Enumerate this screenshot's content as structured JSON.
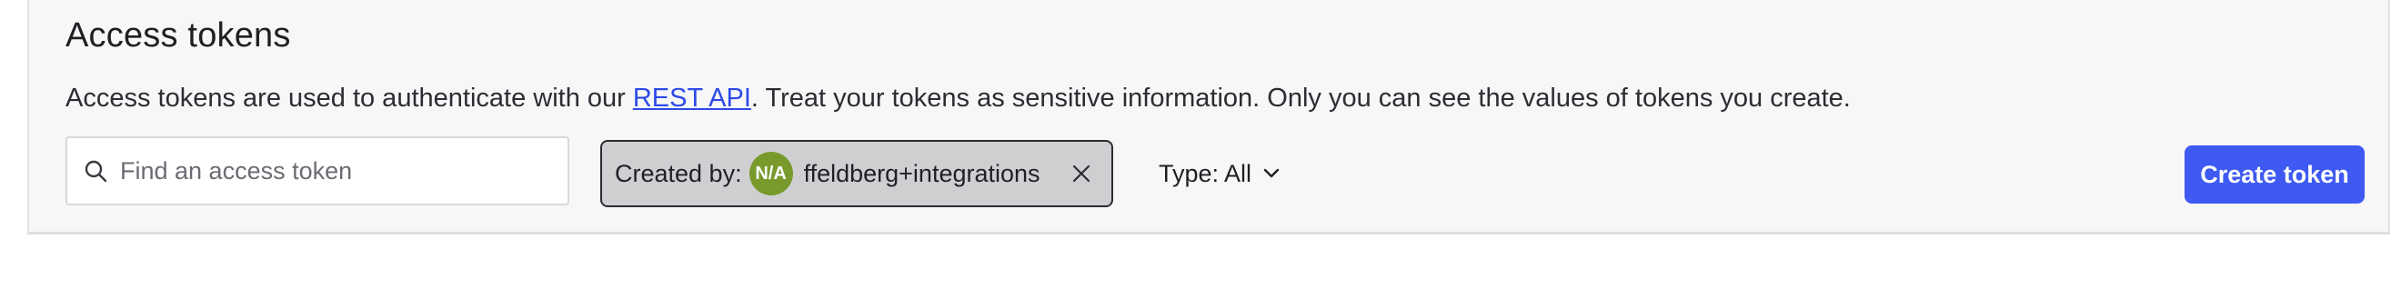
{
  "header": {
    "title": "Access tokens",
    "description_prefix": "Access tokens are used to authenticate with our ",
    "description_link": "REST API",
    "description_suffix": ". Treat your tokens as sensitive information. Only you can see the values of tokens you create."
  },
  "toolbar": {
    "search_placeholder": "Find an access token",
    "search_value": "",
    "created_by": {
      "label": "Created by:",
      "avatar_initials": "N/A",
      "avatar_color": "#789a2c",
      "value": "ffeldberg+integrations"
    },
    "type_filter": {
      "label": "Type: All"
    },
    "create_button": "Create token"
  },
  "colors": {
    "accent": "#3e5af2",
    "link": "#2d4ae8",
    "chip_background": "#cfcfd2"
  },
  "icons": {
    "search": "search-icon",
    "close": "close-icon",
    "chevron": "chevron-down-icon"
  }
}
